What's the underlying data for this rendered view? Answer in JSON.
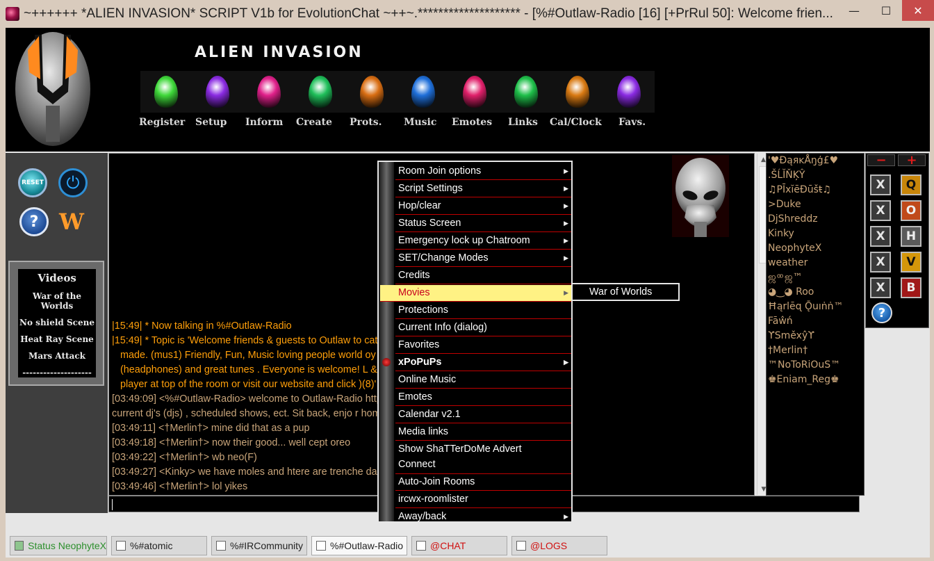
{
  "window": {
    "title": "~++++++ *ALIEN INVASION* SCRIPT V1b for EvolutionChat ~++~.******************** - [%#Outlaw-Radio [16] [+PrRul 50]: Welcome frien...",
    "min_glyph": "—",
    "max_glyph": "☐",
    "close_glyph": "✕"
  },
  "header": {
    "brand": "ALIEN INVASION",
    "menu": [
      {
        "label": "Register",
        "color": "#3fd83a"
      },
      {
        "label": "Setup",
        "color": "#8a2be2"
      },
      {
        "label": "Inform",
        "color": "#e0208a"
      },
      {
        "label": "Create",
        "color": "#1fbf5a"
      },
      {
        "label": "Prots.",
        "color": "#d96e13"
      },
      {
        "label": "Music",
        "color": "#1f6fd9"
      },
      {
        "label": "Emotes",
        "color": "#e0206a"
      },
      {
        "label": "Links",
        "color": "#1fbf4a"
      },
      {
        "label": "Cal/Clock",
        "color": "#d97a13"
      },
      {
        "label": "Favs.",
        "color": "#8a2be2"
      }
    ]
  },
  "left": {
    "reset_label": "RESET",
    "power_icon": "⏻",
    "help_icon": "?",
    "winamp_icon": "W",
    "videos_title": "Videos",
    "videos": [
      "War of the Worlds",
      "No shield Scene",
      "Heat Ray Scene",
      "Mars Attack",
      "--------------------"
    ]
  },
  "chat": {
    "lines": [
      {
        "text": "|15:49| * Now talking in %#Outlaw-Radio",
        "style": "orange"
      },
      {
        "text": "|15:49| * Topic is 'Welcome friends & guests to Outlaw                                                  to catch up with friends already",
        "style": "orange"
      },
      {
        "text": "made. (mus1)   Friendly, Fun, Music loving people world                                                oy Outlaw Radio's Live Dj's",
        "style": "orange-indent"
      },
      {
        "text": "(headphones) and great tunes . Everyone is welcome! L                                                & tunes! (8)(8) To tune in click the",
        "style": "orange-indent"
      },
      {
        "text": "player at top of the room or visit our website and click                                              )(8)'",
        "style": "orange-indent"
      },
      {
        "text": "[03:49:09] <%#Outlaw-Radio> welcome to Outlaw-Radio                                                http://www.outlaw-radio.net/ to see",
        "style": "tan"
      },
      {
        "text": "current dj's (djs) , scheduled shows, ect. Sit back, enjo                                              r home here with us!!!!!",
        "style": "tan"
      },
      {
        "text": "[03:49:11] <†Merlin†> mine did that as a pup",
        "style": "tan"
      },
      {
        "text": "[03:49:18] <†Merlin†> now their good... well cept oreo",
        "style": "tan"
      },
      {
        "text": "[03:49:22] <†Merlin†> wb neo(F)",
        "style": "tan"
      },
      {
        "text": "[03:49:27] <Kinky> we have moles and htere are trenche                                                 darn htings",
        "style": "tan"
      },
      {
        "text": "[03:49:46] <†Merlin†> lol yikes",
        "style": "tan"
      }
    ],
    "scroll_up": "▲",
    "scroll_down": "▼"
  },
  "nicklist": [
    "'♥ĐąяĸÅŋģ£♥",
    ".ŠĹĬŇĶŶ",
    "♫PĪxĭēĐūšŧ♫",
    ">Duke",
    "DjShreddz",
    "Kinky",
    "NeophyteX",
    "weather",
    "   ஜ ͦ ͦ ஜ™",
    "  ◕‿◕     Roo",
    "Ħąrlēɋ Ǭuıṅṅ™",
    "Fāŵń",
    "ϒSměxŷϒ",
    "†Merlin†",
    "™NoToRiOuS™",
    "♚Eniam_Reg♚"
  ],
  "modes": {
    "minus": "−",
    "plus": "+",
    "x_label": "X",
    "mode_buttons": [
      {
        "label": "Q",
        "bg": "#c8860a",
        "fg": "#111"
      },
      {
        "label": "O",
        "bg": "#c04a1a",
        "fg": "#eee"
      },
      {
        "label": "H",
        "bg": "#5a5a5a",
        "fg": "#eee"
      },
      {
        "label": "V",
        "bg": "#d4960a",
        "fg": "#111"
      },
      {
        "label": "B",
        "bg": "#a01818",
        "fg": "#eee"
      }
    ],
    "help": "?"
  },
  "context_menu": {
    "items": [
      {
        "label": "Room Join options",
        "submenu": true
      },
      {
        "label": "Script Settings",
        "submenu": true
      },
      {
        "label": "Hop/clear",
        "submenu": true
      },
      {
        "label": "Status Screen",
        "submenu": true
      },
      {
        "label": "Emergency lock up Chatroom",
        "submenu": true
      },
      {
        "label": "SET/Change Modes",
        "submenu": true
      },
      {
        "label": "Credits",
        "submenu": false
      },
      {
        "label": "Movies",
        "submenu": true,
        "highlighted": true
      },
      {
        "label": "Protections",
        "submenu": false
      },
      {
        "label": "Current Info (dialog)",
        "submenu": false
      },
      {
        "label": "Favorites",
        "submenu": false
      },
      {
        "label": "xPoPuPs",
        "submenu": true,
        "bold": true
      },
      {
        "label": "Online Music",
        "submenu": false
      },
      {
        "label": "Emotes",
        "submenu": false
      },
      {
        "label": "Calendar v2.1",
        "submenu": false
      },
      {
        "label": "Media links",
        "submenu": false
      },
      {
        "label": "Show ShaTTerDoMe Advert\nConnect",
        "submenu": false
      },
      {
        "label": "Auto-Join Rooms",
        "submenu": false
      },
      {
        "label": "ircwx-roomlister",
        "submenu": false
      },
      {
        "label": "Away/back",
        "submenu": true
      }
    ],
    "submenu_arrow": "▶",
    "movies_submenu": [
      "War of Worlds"
    ]
  },
  "tabs": [
    {
      "label": "Status NeophyteX",
      "color": "#2c8f2c",
      "active": false
    },
    {
      "label": "%#atomic",
      "color": "#222",
      "active": false
    },
    {
      "label": "%#IRCommunity",
      "color": "#222",
      "active": false
    },
    {
      "label": "%#Outlaw-Radio",
      "color": "#222",
      "active": true
    },
    {
      "label": "@CHAT",
      "color": "#d01010",
      "active": false
    },
    {
      "label": "@LOGS",
      "color": "#d01010",
      "active": false
    }
  ]
}
